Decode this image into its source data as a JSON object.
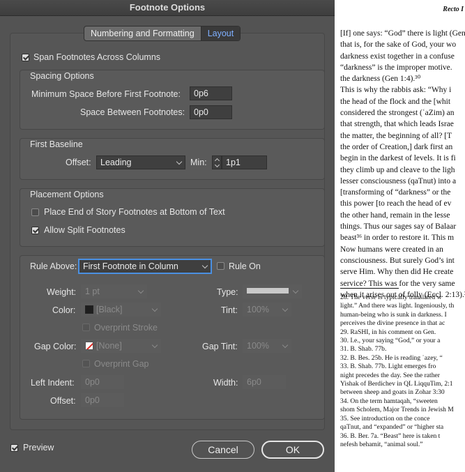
{
  "dialog": {
    "title": "Footnote Options",
    "tabs": [
      {
        "label": "Numbering and Formatting",
        "active": false
      },
      {
        "label": "Layout",
        "active": true
      }
    ],
    "span_footnotes": {
      "label": "Span Footnotes Across Columns",
      "checked": true
    },
    "spacing": {
      "title": "Spacing Options",
      "min_space_label": "Minimum Space Before First Footnote:",
      "min_space_value": "0p6",
      "between_label": "Space Between Footnotes:",
      "between_value": "0p0"
    },
    "baseline": {
      "title": "First Baseline",
      "offset_label": "Offset:",
      "offset_value": "Leading",
      "min_label": "Min:",
      "min_value": "1p1"
    },
    "placement": {
      "title": "Placement Options",
      "end_of_story_label": "Place End of Story Footnotes at Bottom of Text",
      "end_of_story_checked": false,
      "split_label": "Allow Split Footnotes",
      "split_checked": true
    },
    "rule": {
      "rule_above_label": "Rule Above:",
      "rule_above_value": "First Footnote in Column",
      "rule_on_label": "Rule On",
      "rule_on_checked": false,
      "weight_label": "Weight:",
      "weight_value": "1 pt",
      "type_label": "Type:",
      "color_label": "Color:",
      "color_value": "[Black]",
      "tint_label": "Tint:",
      "tint_value": "100%",
      "overprint_stroke_label": "Overprint Stroke",
      "gap_color_label": "Gap Color:",
      "gap_color_value": "[None]",
      "gap_tint_label": "Gap Tint:",
      "gap_tint_value": "100%",
      "overprint_gap_label": "Overprint Gap",
      "left_indent_label": "Left Indent:",
      "left_indent_value": "0p0",
      "width_label": "Width:",
      "width_value": "6p0",
      "offset_label": "Offset:",
      "offset_value": "0p0"
    },
    "preview": {
      "label": "Preview",
      "checked": true
    },
    "cancel_label": "Cancel",
    "ok_label": "OK"
  },
  "document": {
    "running_head": "Recto I",
    "body_lines": [
      "[If] one says: “God” there is light (Gen",
      "that is, for the sake of God, your wo",
      "darkness exist together in a confuse",
      "“darkness” is the improper motive.",
      "the darkness (Gen 1:4).³⁰",
      "    This is why the rabbis ask: “Why i",
      "the head of the flock and the [whit",
      "considered the strongest (ʿaZim) an",
      "that strength, that which leads Israe",
      "the matter, the beginning of all? [T",
      "the order of Creation,] dark first an",
      "begin in the darkest of levels. It is fi",
      "they climb up and cleave to the ligh",
      "lesser consciousness (qaTnut) into a",
      "[transforming of “darkness” or the",
      "this power [to reach the head of ev",
      "the other hand, remain in the lesse",
      "things. Thus our sages say of Balaar",
      "beast³⁶ in order to restore it. This m",
      "    Now humans were created in an",
      "consciousness. But surely God’s int",
      "serve Him. Why then did He create",
      "service? This was for the very same",
      "when it arises out of folly (Eccl. 2:13).³"
    ],
    "note_lines": [
      "    28.  The verse is typically translated w",
      "light.” And there was light. Ingeniously, th",
      "human-being who is sunk in darkness. I",
      "perceives the divine presence in that ac",
      "    29.  RaSHI, in his comment on Gen.",
      "    30.  I.e., your saying “God,” or your a",
      "    31.  B. Shab. 77b.",
      "    32.  B. Bes. 25b. He is reading ʿazey, “",
      "    33.  B. Shab. 77b. Light emerges fro",
      "night precedes the day. See the rather",
      "Yishak of Berdichev in QL LiqquTim, 2:1",
      "between sheep and goats in Zohar 3:30",
      "    34.  On the term hamtaqah, “sweeten",
      "shom Scholem, Major Trends in Jewish M",
      "    35.  See introduction on the conce",
      "qaTnut, and “expanded” or “higher sta",
      "    36.  B. Ber. 7a. “Beast” here is taken t",
      "nefesh behamit, “animal soul.”"
    ]
  }
}
